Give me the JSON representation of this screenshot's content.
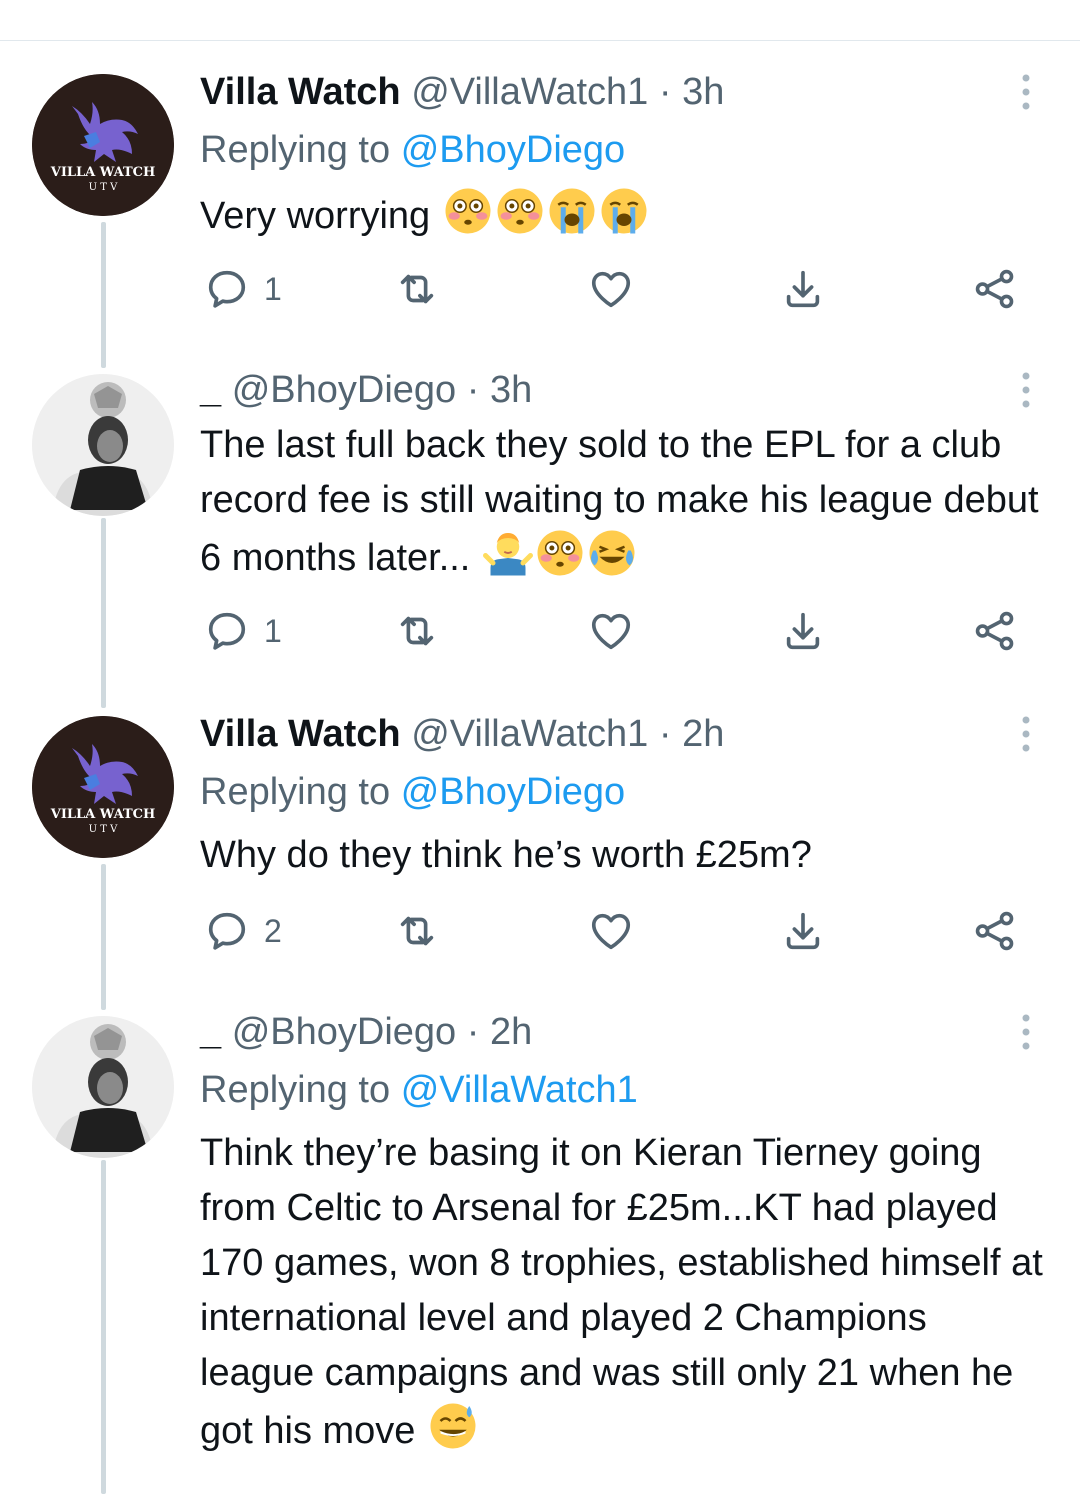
{
  "tweets": [
    {
      "name": "Villa Watch",
      "handle": "@VillaWatch1",
      "time": "3h",
      "replying_label": "Replying to",
      "replying_to": "@BhoyDiego",
      "text": "Very worrying",
      "emojis": [
        "flushed-face",
        "flushed-face",
        "loudly-crying-face",
        "loudly-crying-face"
      ],
      "reply_count": "1",
      "avatar_text": "VILLA WATCH",
      "avatar_subtext": "U T V"
    },
    {
      "name": "_",
      "handle": "@BhoyDiego",
      "time": "3h",
      "text": "The last full back they sold to the EPL for a club record fee is still waiting to make his league debut 6 months later...",
      "emojis": [
        "man-shrugging",
        "flushed-face",
        "face-with-tears-of-joy"
      ],
      "reply_count": "1"
    },
    {
      "name": "Villa Watch",
      "handle": "@VillaWatch1",
      "time": "2h",
      "replying_label": "Replying to",
      "replying_to": "@BhoyDiego",
      "text": "Why do they think he’s worth £25m?",
      "reply_count": "2",
      "avatar_text": "VILLA WATCH",
      "avatar_subtext": "U T V"
    },
    {
      "name": "_",
      "handle": "@BhoyDiego",
      "time": "2h",
      "replying_label": "Replying to",
      "replying_to": "@VillaWatch1",
      "text": "Think they’re basing it on Kieran Tierney going from Celtic to Arsenal for £25m...KT had played 170 games, won 8 trophies, established himself at international level and played 2 Champions league campaigns and was still only 21 when he got his move",
      "emojis": [
        "grinning-face-with-sweat"
      ]
    }
  ],
  "icons": {
    "reply": "reply-icon",
    "retweet": "retweet-icon",
    "like": "heart-icon",
    "share": "share-icon",
    "send": "share-network-icon",
    "more": "more-options-icon"
  },
  "colors": {
    "text": "#0f1419",
    "secondary": "#536471",
    "link": "#1d9bf0",
    "thread_line": "#cfd9de",
    "icon": "#536471"
  }
}
